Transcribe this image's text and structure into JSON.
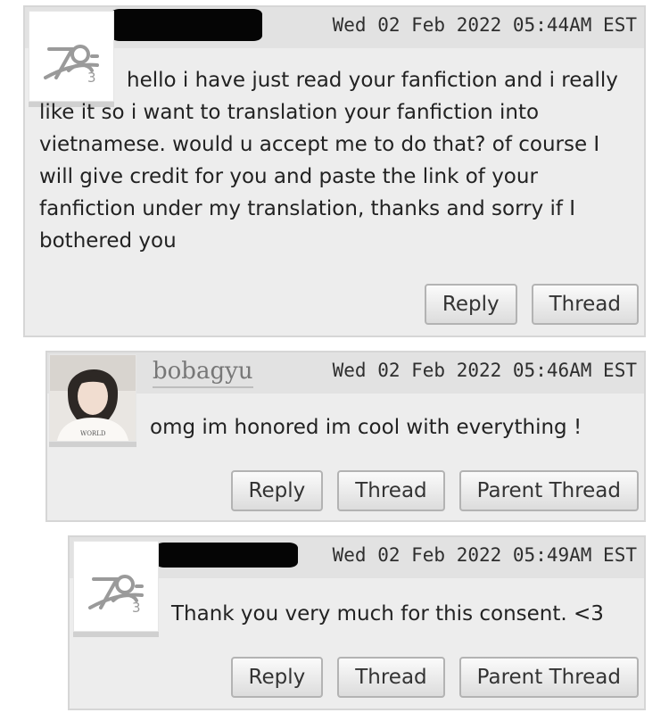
{
  "comments": [
    {
      "timestamp": "Wed 02 Feb 2022 05:44AM EST",
      "username": "",
      "avatar_icon": "default-user-avatar-icon",
      "body": "hello i have just read your fanfiction and i really like it so i want to translation your fanfiction into vietnamese. would u accept me to do that? of course I will give credit for you and paste the link of your fanfiction under my translation, thanks and sorry if I bothered you",
      "actions": [
        "Reply",
        "Thread"
      ]
    },
    {
      "timestamp": "Wed 02 Feb 2022 05:46AM EST",
      "username": "bobagyu",
      "avatar_icon": "profile-photo-avatar",
      "body": "omg im honored im cool with everything !",
      "actions": [
        "Reply",
        "Thread",
        "Parent Thread"
      ]
    },
    {
      "timestamp": "Wed 02 Feb 2022 05:49AM EST",
      "username": "",
      "avatar_icon": "default-user-avatar-icon",
      "body": "Thank you very much for this consent. <3",
      "actions": [
        "Reply",
        "Thread",
        "Parent Thread"
      ]
    }
  ]
}
